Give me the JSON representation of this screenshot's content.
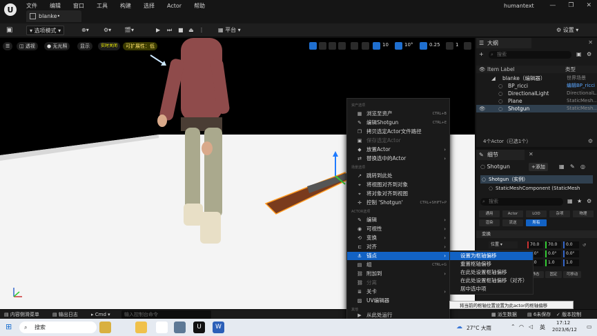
{
  "titlebar": {
    "menus": [
      "文件",
      "编辑",
      "窗口",
      "工具",
      "构建",
      "选择",
      "Actor",
      "帮助"
    ],
    "doc_tab": "blanke•",
    "project": "humantext",
    "controls": [
      "—",
      "❐",
      "✕"
    ]
  },
  "toolbar": {
    "mode": "选项模式",
    "platform": "平台",
    "settings": "设置"
  },
  "viewport": {
    "perspective": "透视",
    "lighting": "无光照",
    "show": "显示",
    "realtime": "实时关闭",
    "scalability": "可扩展性：低",
    "grid_snap": "10",
    "rot_snap": "10°",
    "scale_snap": "0.25",
    "camera": "1"
  },
  "context_menu": {
    "sections": [
      "资产选项",
      "场景选项",
      "ACTOR选项",
      "其他"
    ],
    "items": [
      {
        "label": "浏览至资产",
        "shortcut": "CTRL+B",
        "icon": "▦"
      },
      {
        "label": "编辑Shotgun",
        "shortcut": "CTRL+E",
        "icon": "✎"
      },
      {
        "label": "拷贝选定Actor文件路径",
        "shortcut": "",
        "icon": "❐"
      },
      {
        "label": "保存选定Actor",
        "shortcut": "",
        "icon": "▣",
        "disabled": true
      },
      {
        "label": "放置Actor",
        "shortcut": "",
        "icon": "◆",
        "submenu": true
      },
      {
        "label": "替换选中的Actor",
        "shortcut": "",
        "icon": "⇄",
        "submenu": true
      },
      {
        "label": "跳转到此处",
        "shortcut": "",
        "icon": "↗"
      },
      {
        "label": "将视图对齐到对象",
        "shortcut": "",
        "icon": "⌖"
      },
      {
        "label": "将对象对齐到视图",
        "shortcut": "",
        "icon": "⌖"
      },
      {
        "label": "控制 'Shotgun'",
        "shortcut": "CTRL+SHIFT+P",
        "icon": "✛"
      },
      {
        "label": "编辑",
        "shortcut": "",
        "icon": "✎",
        "submenu": true
      },
      {
        "label": "可视性",
        "shortcut": "",
        "icon": "◉",
        "submenu": true
      },
      {
        "label": "变换",
        "shortcut": "",
        "icon": "⟲",
        "submenu": true
      },
      {
        "label": "对齐",
        "shortcut": "",
        "icon": "⊏",
        "submenu": true
      },
      {
        "label": "锚点",
        "shortcut": "",
        "icon": "⚓",
        "submenu": true,
        "selected": true
      },
      {
        "label": "组",
        "shortcut": "CTRL+G",
        "icon": "▤"
      },
      {
        "label": "附加到",
        "shortcut": "",
        "icon": "⛓",
        "submenu": true
      },
      {
        "label": "分离",
        "shortcut": "",
        "icon": "⛓",
        "disabled": true
      },
      {
        "label": "关卡",
        "shortcut": "",
        "icon": "≣",
        "submenu": true
      },
      {
        "label": "UV编辑器",
        "shortcut": "",
        "icon": "▨"
      },
      {
        "label": "从此处运行",
        "shortcut": "",
        "icon": "▶"
      }
    ]
  },
  "submenu": {
    "items": [
      "设置为枢轴偏移",
      "重置枢轴偏移",
      "在此处设置枢轴偏移",
      "在此处设置枢轴偏移（对齐）",
      "居中选中项"
    ],
    "tooltip": "将当前的枢轴位置设置为此actor的枢轴偏移"
  },
  "outliner": {
    "tab": "大纲",
    "search_placeholder": "搜索",
    "col_label": "Item Label",
    "col_type": "类型",
    "rows": [
      {
        "name": "blanke（编辑器）",
        "type": "世界场景"
      },
      {
        "name": "BP_ricci",
        "type": "编辑BP_ricci"
      },
      {
        "name": "DirectionalLight",
        "type": "DirectionalL..."
      },
      {
        "name": "Plane",
        "type": "StaticMesh..."
      },
      {
        "name": "Shotgun",
        "type": "StaticMesh..."
      }
    ],
    "footer": "4个Actor（已选1个）"
  },
  "details": {
    "tab": "细节",
    "actor": "Shotgun",
    "add": "+添加",
    "instance": "Shotgun（实例）",
    "component": "StaticMeshComponent (StaticMesh",
    "search_placeholder": "搜索",
    "filters": [
      "通用",
      "Actor",
      "LOD",
      "杂项",
      "物理",
      "渲染",
      "流送",
      "所有"
    ],
    "section": "变换",
    "location_label": "位置",
    "location": [
      "70.0",
      "70.0",
      "0.0"
    ],
    "rotation": [
      "0.0°",
      "0.0°",
      "0.0°"
    ],
    "scale": [
      "1.0",
      "1.0",
      "1.0"
    ],
    "mobility": [
      "静态",
      "固定",
      "可移动"
    ]
  },
  "statusbar": {
    "content_drawer": "内容侧滑菜单",
    "output_log": "输出日志",
    "cmd": "Cmd",
    "cmd_placeholder": "输入控制台命令",
    "derived_data": "派生数据",
    "unsaved": "6未保存",
    "version": "版本控制"
  },
  "taskbar": {
    "search": "搜索",
    "weather": "27°C 大雨",
    "ime": "英",
    "time": "17:12",
    "date": "2023/6/12"
  }
}
